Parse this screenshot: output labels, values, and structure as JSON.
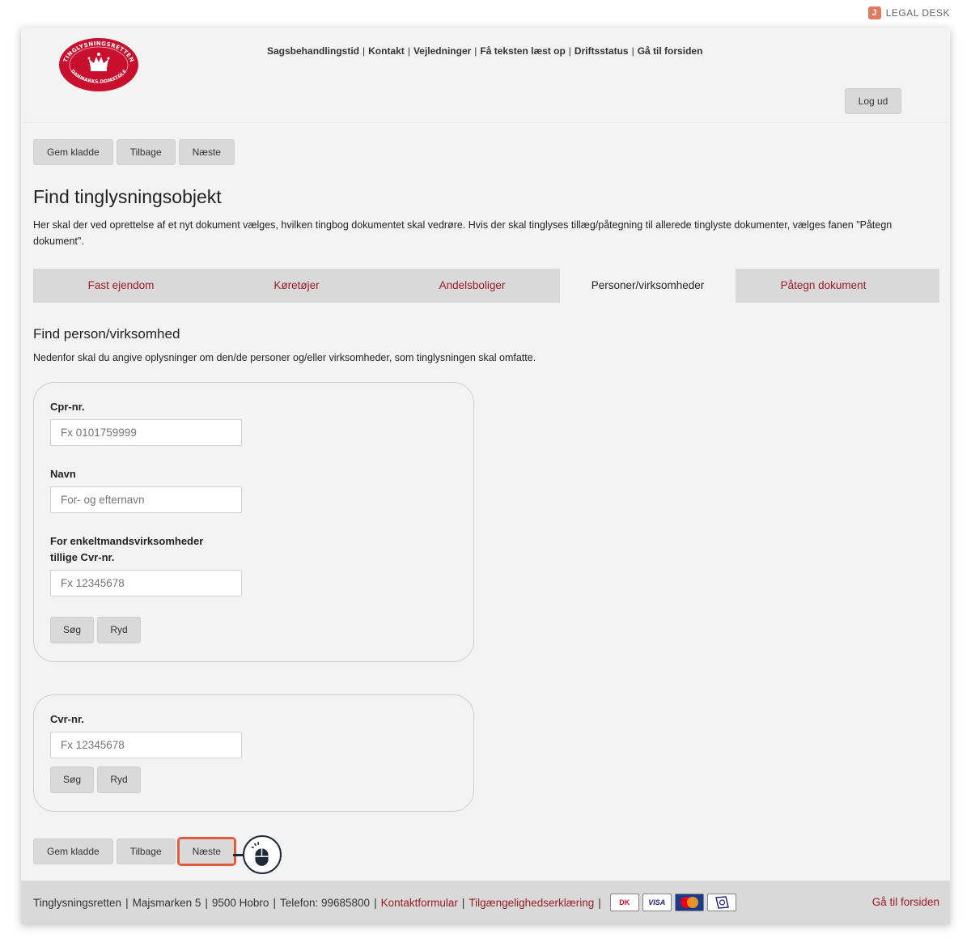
{
  "brand": {
    "label": "LEGAL DESK"
  },
  "header": {
    "logo_ring_top": "TINGLYSNINGSRETTEN",
    "logo_ring_bottom": "DANMARKS DOMSTOLE",
    "nav": [
      "Sagsbehandlingstid",
      "Kontakt",
      "Vejledninger",
      "Få teksten læst op",
      "Driftsstatus",
      "Gå til forsiden"
    ],
    "nav_separator": "|",
    "logout_label": "Log ud"
  },
  "actions": {
    "save_draft": "Gem kladde",
    "back": "Tilbage",
    "next": "Næste"
  },
  "page": {
    "title": "Find tinglysningsobjekt",
    "intro": "Her skal der ved oprettelse af et nyt dokument vælges, hvilken tingbog dokumentet skal vedrøre. Hvis der skal tinglyses tillæg/påtegning til allerede tinglyste dokumenter, vælges fanen \"Påtegn dokument\"."
  },
  "tabs": [
    {
      "label": "Fast ejendom",
      "active": false
    },
    {
      "label": "Køretøjer",
      "active": false
    },
    {
      "label": "Andelsboliger",
      "active": false
    },
    {
      "label": "Personer/virksomheder",
      "active": true
    },
    {
      "label": "Påtegn dokument",
      "active": false
    }
  ],
  "section": {
    "title": "Find person/virksomhed",
    "description": "Nedenfor skal du angive oplysninger om den/de personer og/eller virksomheder, som tinglysningen skal omfatte."
  },
  "person_form": {
    "cpr_label": "Cpr-nr.",
    "cpr_placeholder": "Fx 0101759999",
    "name_label": "Navn",
    "name_placeholder": "For- og efternavn",
    "cvr_label_line1": "For enkeltmandsvirksomheder",
    "cvr_label_line2": "tillige Cvr-nr.",
    "cvr_placeholder": "Fx 12345678",
    "search_label": "Søg",
    "clear_label": "Ryd"
  },
  "company_form": {
    "cvr_label": "Cvr-nr.",
    "cvr_placeholder": "Fx 12345678",
    "search_label": "Søg",
    "clear_label": "Ryd"
  },
  "footer": {
    "org": "Tinglysningsretten",
    "address": "Majsmarken 5",
    "city": "9500 Hobro",
    "phone": "Telefon: 99685800",
    "contact_link": "Kontaktformular",
    "accessibility_link": "Tilgængelighedserklæring",
    "home_link": "Gå til forsiden",
    "separator": "|",
    "cards": [
      "DK",
      "VISA",
      "MasterCard",
      "other-card"
    ]
  },
  "colors": {
    "accent": "#9b1c24",
    "highlight": "#e05a3c",
    "background": "#f3f3f3",
    "button": "#d9d9d9"
  },
  "icons": [
    "mouse-click-icon",
    "royal-crown-icon"
  ]
}
